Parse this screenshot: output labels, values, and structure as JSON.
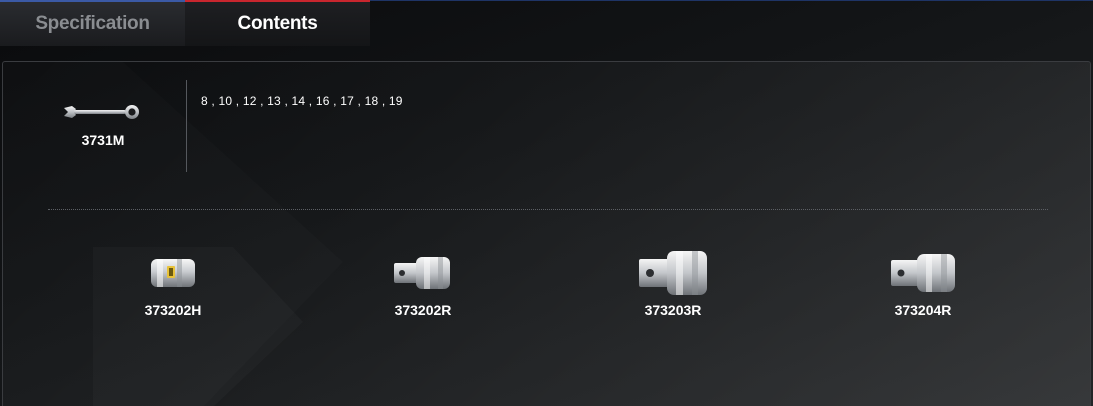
{
  "tabs": [
    {
      "label": "Specification",
      "active": false
    },
    {
      "label": "Contents",
      "active": true
    }
  ],
  "top_item": {
    "label": "3731M",
    "icon": "combination-wrench-icon",
    "sizes": "8 , 10 , 12 , 13 , 14 , 16 , 17 , 18 , 19"
  },
  "bottom_items": [
    {
      "label": "373202H",
      "icon": "hex-socket-icon"
    },
    {
      "label": "373202R",
      "icon": "socket-adapter-icon"
    },
    {
      "label": "373203R",
      "icon": "socket-adapter-icon"
    },
    {
      "label": "373204R",
      "icon": "socket-adapter-icon"
    }
  ],
  "colors": {
    "spec_tab_accent": "#3b5aa6",
    "contents_tab_accent": "#c8262e",
    "background": "#0d0e10"
  }
}
